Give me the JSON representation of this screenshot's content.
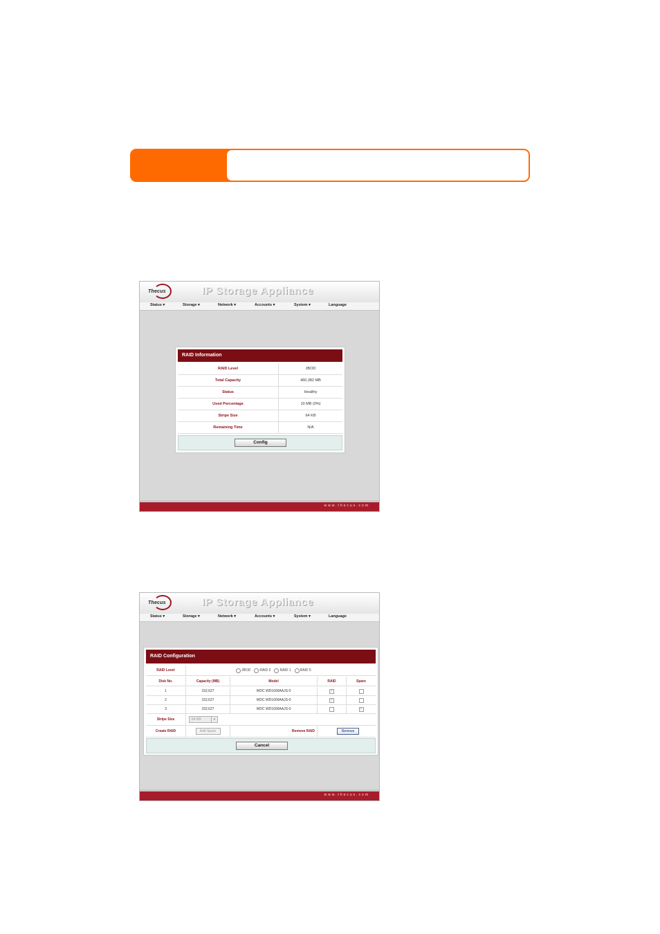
{
  "banner": {
    "tab_label": "",
    "box_text": ""
  },
  "screens": [
    {
      "app_title": "IP Storage Appliance",
      "logo_text": "Thecus",
      "menu": [
        "Status ▾",
        "Storage ▾",
        "Network ▾",
        "Accounts ▾",
        "System ▾",
        "Language"
      ],
      "footer_url": "www.thecus.com",
      "panel_title": "RAID Information",
      "rows": [
        {
          "label": "RAID Level",
          "value": "JBOD"
        },
        {
          "label": "Total Capacity",
          "value": "460,382 MB"
        },
        {
          "label": "Status",
          "value": "Healthy"
        },
        {
          "label": "Used Percentage",
          "value": "10 MB (0%)"
        },
        {
          "label": "Stripe Size",
          "value": "64 KB"
        },
        {
          "label": "Remaining Time",
          "value": "N/A"
        }
      ],
      "button": "Config"
    },
    {
      "app_title": "IP Storage Appliance",
      "logo_text": "Thecus",
      "menu": [
        "Status ▾",
        "Storage ▾",
        "Network ▾",
        "Accounts ▾",
        "System ▾",
        "Language"
      ],
      "footer_url": "www.thecus.com",
      "panel_title": "RAID Configuration",
      "raid_level_label": "RAID Level",
      "raid_options": [
        "JBOD",
        "RAID 0",
        "RAID 1",
        "RAID 5"
      ],
      "columns": [
        "Disk No.",
        "Capacity (MB)",
        "Model",
        "RAID",
        "Spare"
      ],
      "disks": [
        {
          "no": "1",
          "capacity": "152,627",
          "model": "WDC WD1600AAJS-0",
          "raid": "✓",
          "spare": ""
        },
        {
          "no": "2",
          "capacity": "152,627",
          "model": "WDC WD1600AAJS-0",
          "raid": "✓",
          "spare": ""
        },
        {
          "no": "3",
          "capacity": "152,627",
          "model": "WDC WD1600AAJS-0",
          "raid": "",
          "spare": "✓"
        }
      ],
      "stripe_label": "Stripe Size",
      "stripe_value": "64 KB",
      "create_label": "Create RAID",
      "add_spare": "Add Spare",
      "remove_label": "Remove RAID",
      "remove_button": "Remove",
      "button": "Cancel"
    }
  ]
}
